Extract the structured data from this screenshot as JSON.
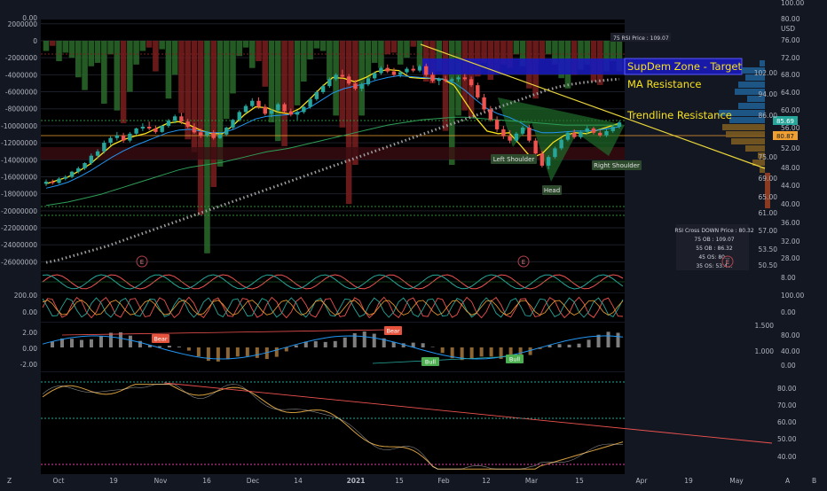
{
  "chart_data": {
    "type": "line",
    "x_tick_labels": [
      "Oct",
      "19",
      "Nov",
      "16",
      "Dec",
      "14",
      "2021",
      "15",
      "Feb",
      "12",
      "Mar",
      "15",
      "Apr",
      "19",
      "May"
    ],
    "x_tick_labels_bold": [
      "2021"
    ],
    "price_axis": {
      "labels": [
        "100.00",
        "80.00",
        "USD",
        "76.00",
        "72.00",
        "68.00",
        "64.00",
        "60.00",
        "56.00",
        "52.00",
        "48.00",
        "44.00",
        "40.00",
        "36.00",
        "32.00",
        "28.00"
      ],
      "range": [
        24,
        82
      ]
    },
    "ma_axis": {
      "labels": [
        "102.00",
        "94.00",
        "86.00",
        "75.00",
        "69.00",
        "65.00",
        "61.00",
        "57.00",
        "53.50",
        "50.50"
      ]
    },
    "volume_axis": {
      "labels": [
        "0.00",
        "2000000",
        "0",
        "-2000000",
        "-4000000",
        "-6000000",
        "-8000000",
        "-10000000",
        "-12000000",
        "-14000000",
        "-16000000",
        "-18000000",
        "-20000000",
        "-22000000",
        "-24000000",
        "-26000000"
      ],
      "range": [
        -27000000,
        2500000
      ]
    },
    "candles": [
      [
        44,
        45,
        43.5,
        44.5
      ],
      [
        44.5,
        45,
        43.8,
        44.2
      ],
      [
        44.2,
        45.5,
        44,
        45.2
      ],
      [
        45.2,
        46,
        44.8,
        45.6
      ],
      [
        45.6,
        47,
        45.3,
        46.8
      ],
      [
        46.8,
        48,
        46.4,
        47.6
      ],
      [
        47.6,
        49,
        47.2,
        48.8
      ],
      [
        48.8,
        51,
        48.4,
        50.5
      ],
      [
        50.5,
        52,
        49.8,
        51.5
      ],
      [
        51.5,
        54,
        51,
        53.5
      ],
      [
        53.5,
        55,
        52.8,
        54.6
      ],
      [
        54.6,
        56,
        54,
        55.2
      ],
      [
        55.2,
        55.8,
        53.5,
        54
      ],
      [
        54,
        56,
        53.6,
        55.6
      ],
      [
        55.6,
        57,
        55.2,
        56.8
      ],
      [
        56.8,
        58,
        56.2,
        57.2
      ],
      [
        57.2,
        58.4,
        56.4,
        56.8
      ],
      [
        56.8,
        57.5,
        55.6,
        56
      ],
      [
        56,
        57.6,
        55.8,
        57.4
      ],
      [
        57.4,
        59,
        57,
        58.6
      ],
      [
        58.6,
        60,
        58,
        59.6
      ],
      [
        59.6,
        60.4,
        57.8,
        58.4
      ],
      [
        58.4,
        59,
        56.8,
        57.2
      ],
      [
        57.2,
        58,
        55.6,
        55.9
      ],
      [
        55.9,
        56.8,
        54.6,
        55.2
      ],
      [
        55.2,
        56.2,
        54.8,
        55.8
      ],
      [
        55.8,
        56.4,
        54.2,
        54.6
      ],
      [
        54.6,
        55.8,
        54.3,
        55.4
      ],
      [
        55.4,
        57.2,
        55,
        57
      ],
      [
        57,
        59,
        56.6,
        58.8
      ],
      [
        58.8,
        61,
        58.4,
        60.6
      ],
      [
        60.6,
        62.4,
        60.2,
        62
      ],
      [
        62,
        63.8,
        61.6,
        63.2
      ],
      [
        63.2,
        64,
        61.4,
        61.8
      ],
      [
        61.8,
        62.4,
        59.8,
        60.2
      ],
      [
        60.2,
        61.4,
        59.4,
        61
      ],
      [
        61,
        62.8,
        60.6,
        62.4
      ],
      [
        62.4,
        62.8,
        60.4,
        60.8
      ],
      [
        60.8,
        61.4,
        59.6,
        60
      ],
      [
        60,
        61,
        58.8,
        60.6
      ],
      [
        60.6,
        62,
        60.2,
        61.8
      ],
      [
        61.8,
        64,
        61.4,
        63.6
      ],
      [
        63.6,
        65.6,
        63.2,
        65.2
      ],
      [
        65.2,
        67,
        64.8,
        66.6
      ],
      [
        66.6,
        68.6,
        66.2,
        68.2
      ],
      [
        68.2,
        69.6,
        67.8,
        69.2
      ],
      [
        69.2,
        70.4,
        68.4,
        68.8
      ],
      [
        68.8,
        69.4,
        66.8,
        67.2
      ],
      [
        67.2,
        68,
        65.6,
        66
      ],
      [
        66,
        67.4,
        65.4,
        67
      ],
      [
        67,
        68.8,
        66.6,
        68.4
      ],
      [
        68.4,
        70,
        68,
        69.6
      ],
      [
        69.6,
        71.2,
        69.2,
        70.8
      ],
      [
        70.8,
        71.6,
        69.6,
        70
      ],
      [
        70,
        70.8,
        68.8,
        69.2
      ],
      [
        69.2,
        70.2,
        68.6,
        69.8
      ],
      [
        69.8,
        71,
        69.4,
        70.6
      ],
      [
        70.6,
        71.4,
        69.8,
        70.2
      ],
      [
        70.2,
        71.6,
        69.8,
        71.2
      ],
      [
        71.2,
        71.8,
        68.8,
        69.2
      ],
      [
        69.2,
        69.8,
        67.4,
        67.8
      ],
      [
        67.8,
        68.6,
        66.8,
        68.2
      ],
      [
        68.2,
        69,
        67.4,
        67.8
      ],
      [
        67.8,
        68.6,
        67.2,
        68.2
      ],
      [
        68.2,
        69,
        67.6,
        68.6
      ],
      [
        68.6,
        69.4,
        67.8,
        68.2
      ],
      [
        68.2,
        68.8,
        66.4,
        66.8
      ],
      [
        66.8,
        67.4,
        63.6,
        64
      ],
      [
        64,
        64.8,
        60.6,
        61.2
      ],
      [
        61.2,
        62,
        58.4,
        58.8
      ],
      [
        58.8,
        59.6,
        56,
        56.6
      ],
      [
        56.6,
        57.4,
        54.4,
        55
      ],
      [
        55,
        56.4,
        53.4,
        54
      ],
      [
        54,
        56,
        53.6,
        55.6
      ],
      [
        55.6,
        57.4,
        55.2,
        57
      ],
      [
        57,
        57.6,
        53.6,
        54
      ],
      [
        54,
        54.6,
        50.6,
        51
      ],
      [
        51,
        51.6,
        47.8,
        48.2
      ],
      [
        48.2,
        50.6,
        47.4,
        50.2
      ],
      [
        50.2,
        52.6,
        49.8,
        52.2
      ],
      [
        52.2,
        54.6,
        51.8,
        54.2
      ],
      [
        54.2,
        56.2,
        53.8,
        55.8
      ],
      [
        55.8,
        56.6,
        54.4,
        54.8
      ],
      [
        54.8,
        56.4,
        54.4,
        56
      ],
      [
        56,
        57.4,
        55.4,
        56.8
      ],
      [
        56.8,
        57.2,
        55.4,
        55.8
      ],
      [
        55.8,
        56.4,
        54.8,
        55.2
      ],
      [
        55.2,
        56.6,
        54.8,
        56.2
      ],
      [
        56.2,
        57.6,
        55.8,
        57.2
      ],
      [
        57.2,
        58.6,
        56.8,
        58.2
      ]
    ],
    "volume": [
      -1.2,
      -0.6,
      -2.4,
      -1.4,
      -2.0,
      -4.3,
      -5.8,
      -3.0,
      -2.6,
      -7.4,
      -1.6,
      -8.2,
      -9.7,
      -6.0,
      -2.8,
      -1.2,
      -0.8,
      -3.6,
      -1.0,
      -6.8,
      -4.0,
      -8.5,
      -11.6,
      -13.1,
      -20.5,
      -25.0,
      -17.2,
      -14.8,
      -9.2,
      -6.2,
      -1.8,
      -0.8,
      -3.2,
      -2.4,
      -5.4,
      -9.6,
      -11.8,
      -12.4,
      -8.2,
      -7.6,
      -4.8,
      -2.2,
      -0.9,
      -1.2,
      -4.6,
      -8.8,
      -10.2,
      -19.2,
      -14.6,
      -8.8,
      -4.4,
      -2.6,
      -3.2,
      -1.6,
      -1.4,
      -2.8,
      -2.0,
      -0.7,
      -3.0,
      -4.8,
      -5.0,
      -3.6,
      -10.6,
      -14.6,
      -8.8,
      -8.2,
      -9.0,
      -4.2,
      -2.6,
      -4.6,
      -3.8,
      -2.8,
      -3.2,
      -1.6,
      -3.0,
      -5.6,
      -6.8,
      -2.2,
      -1.6,
      -2.8,
      -4.4,
      -5.6,
      -4.0,
      -3.4,
      -2.8,
      -4.8,
      -5.2,
      -3.6,
      -2.4,
      -3.6
    ],
    "series": [
      {
        "values": [
          44,
          44.8,
          45.6,
          47,
          48.6,
          50.8,
          53,
          54.2,
          55,
          55.6,
          56.8,
          58,
          58.4,
          57.6,
          56.4,
          55.6,
          55.6,
          57.6,
          60,
          61.8,
          61.6,
          60.6,
          60.2,
          61.4,
          63.8,
          66.4,
          68.6,
          68.4,
          67.6,
          68.6,
          70,
          70.4,
          70.2,
          68.6,
          68.4,
          68.4,
          68.2,
          66.8,
          63,
          59.2,
          56.2,
          55.6,
          55.8,
          53,
          50,
          51,
          53.6,
          55.2,
          55.8,
          55.6,
          56.4,
          57.2,
          58
        ]
      },
      {
        "values": [
          43,
          43.6,
          44.4,
          45.6,
          47,
          48.6,
          50.2,
          51.6,
          52.8,
          53.8,
          54.8,
          55.8,
          56.4,
          56.6,
          56.2,
          55.8,
          55.8,
          56.6,
          57.8,
          59,
          59.6,
          59.8,
          60,
          60.6,
          61.8,
          63.4,
          65,
          66,
          66.6,
          67.2,
          68,
          68.6,
          69,
          68.8,
          68.6,
          68.4,
          68.2,
          67.4,
          65.6,
          63.4,
          61.4,
          60.2,
          59.4,
          58.2,
          56.6,
          55.8,
          55.8,
          56,
          56.2,
          56.2,
          56.4,
          56.8,
          57.2
        ]
      },
      {
        "values": [
          39,
          39.4,
          39.8,
          40.4,
          41,
          41.6,
          42.4,
          43.2,
          44,
          44.8,
          45.6,
          46.4,
          47.2,
          47.8,
          48.2,
          48.6,
          49,
          49.6,
          50.2,
          50.8,
          51.4,
          51.8,
          52.2,
          52.8,
          53.4,
          54,
          54.6,
          55.2,
          55.8,
          56.4,
          57,
          57.6,
          58,
          58.4,
          58.8,
          59,
          59.2,
          59.4,
          59.4,
          59.2,
          59,
          58.8,
          58.6,
          58.4,
          58.2,
          58,
          57.8,
          57.6,
          57.6,
          57.6,
          57.6,
          57.6,
          57.6
        ]
      },
      {
        "values": [
          25.8,
          26.4,
          27.2,
          28,
          28.8,
          29.6,
          30.6,
          31.6,
          32.6,
          33.6,
          34.6,
          35.6,
          36.6,
          37.6,
          38.6,
          39.6,
          40.6,
          41.6,
          42.6,
          43.6,
          44.6,
          45.6,
          46.6,
          47.6,
          48.6,
          49.6,
          50.6,
          51.6,
          52.6,
          53.6,
          54.6,
          55.6,
          56.6,
          57.6,
          58.6,
          59.6,
          60.6,
          61.6,
          62.6,
          63.6,
          64.6,
          65.6,
          66.4,
          67,
          67.4,
          67.7,
          68,
          68.2
        ]
      }
    ],
    "ranges": {
      "rsi": [
        0,
        100
      ],
      "stoch": [
        -15,
        215
      ],
      "wave": [
        -2.6,
        2.6
      ],
      "osc": [
        33,
        90
      ]
    },
    "annotations": {
      "supdem": "SupDem Zone - Target",
      "ma_resistance": "MA Resistance",
      "trendline": "Trendline Resistance",
      "left_shoulder": "Left Shoulder",
      "head": "Head",
      "right_shoulder": "Right Shoulder",
      "rsi_price_top": "75 RSI Price : 109.07",
      "cross_box": [
        "RSI Cross DOWN Price : 80.32",
        "75 OB : 109.07",
        "55 OB : 86.32",
        "45 OS: 80...",
        "35 OS: 53.4..."
      ],
      "bear1": "Bear",
      "bear2": "Bear",
      "bull1": "Bull",
      "bull2": "Bull",
      "earnings": "E"
    },
    "price_badges": {
      "cyan": "85.69",
      "orange": "80.87"
    },
    "sub_axes": {
      "pane1": [
        "8.00"
      ],
      "pane2_left": [
        "200.00",
        "0.00"
      ],
      "pane2_right": [
        "100.00",
        "0.00"
      ],
      "pane3_left": [
        "2.00",
        "0.00",
        "-2.00"
      ],
      "pane3_right_a": [
        "1.500",
        "1.000"
      ],
      "pane3_right_b": [
        "80.00",
        "40.00",
        "0.00"
      ],
      "pane4": [
        "80.00",
        "70.00",
        "60.00",
        "50.00",
        "40.00"
      ]
    },
    "bottom_letters": {
      "left": "Z",
      "right_a": "A",
      "right_b": "B"
    },
    "colors": {
      "background": "#131722",
      "up": "#26a69a",
      "down": "#ef5350",
      "ma_fast": "#f7e11a",
      "ma_mid": "#2196f3",
      "ma_slow": "#2e9e56",
      "ma_dots": "#9e9e9e",
      "trend": "#e8d43a",
      "supdem_fill": "#1a1ab8",
      "supdem_text": "#f7e11a",
      "hs_fill": "#1e6b2a",
      "badge_cyan": "#26a69a",
      "badge_orange": "#f0a030"
    }
  }
}
